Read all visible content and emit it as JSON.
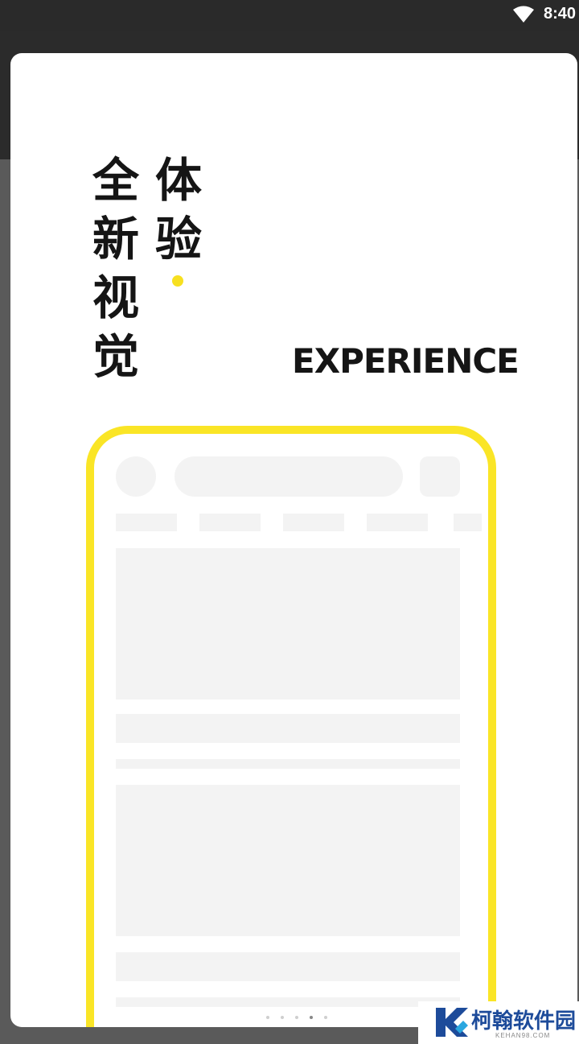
{
  "status_bar": {
    "time": "8:40",
    "wifi_icon": "wifi-icon"
  },
  "splash": {
    "title_left_column": [
      "全",
      "新",
      "视",
      "觉"
    ],
    "title_right_column": [
      "体",
      "验"
    ],
    "subtitle": "EXPERIENCE",
    "accent_color": "#fae526",
    "text_color": "#151515"
  },
  "watermark": {
    "logo_icon": "k-logo-icon",
    "name": "柯翰软件园",
    "url": "KEHAN98.COM",
    "color": "#1d4b9a"
  }
}
